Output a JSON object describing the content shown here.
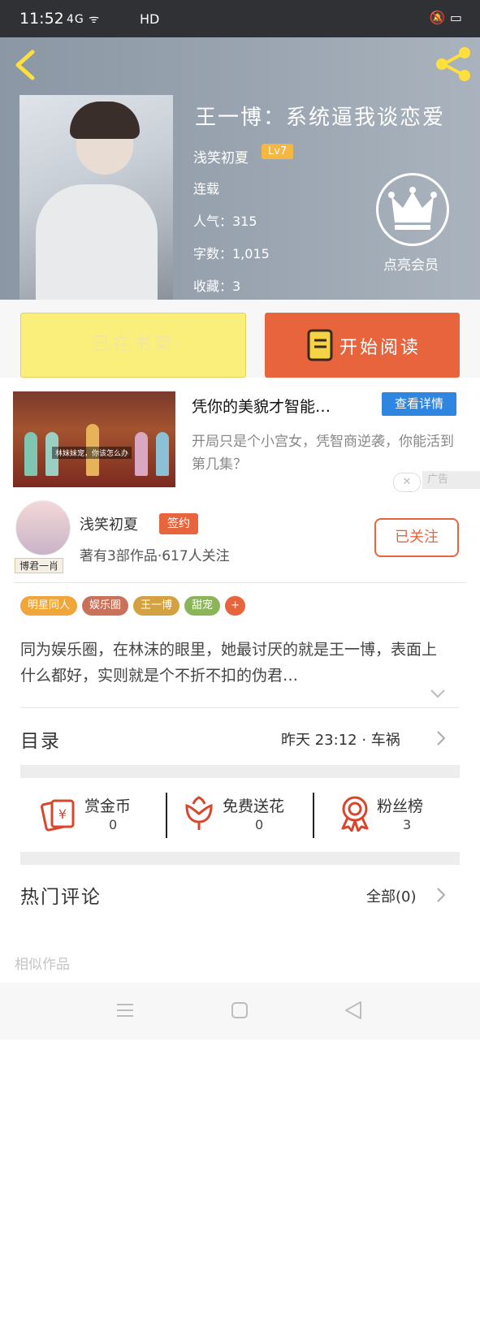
{
  "status_bar": {
    "time": "11:52",
    "network": "4G  ᯤ",
    "hd": "HD",
    "right_icons": "🔕 ▭"
  },
  "header": {
    "back_icon": "chevron-left-icon",
    "share_icon": "share-icon"
  },
  "book": {
    "title": "王一博：系统逼我谈恋爱",
    "author": "浅笑初夏",
    "level": "Lv7",
    "status": "连载",
    "popularity": "人气：315",
    "word_count": "字数：1,015",
    "favorites": "收藏：3",
    "member_label": "点亮会员"
  },
  "actions": {
    "shelf_label": "已在书架",
    "read_label": "开始阅读"
  },
  "ad": {
    "title": "凭你的美貌才智能…",
    "detail_button": "查看详情",
    "description": "开局只是个小宫女，凭智商逆袭，你能活到第几集？",
    "image_caption": "林妹妹宠，你该怎么办",
    "close_label": "✕",
    "ad_label": "广告"
  },
  "author_card": {
    "name": "浅笑初夏",
    "badge": "签约",
    "avatar_tag": "博君一肖",
    "works_followers": "著有3部作品·617人关注",
    "follow_button": "已关注"
  },
  "tags": [
    {
      "label": "明星同人",
      "color": "#f0a63a"
    },
    {
      "label": "娱乐圈",
      "color": "#c9715a"
    },
    {
      "label": "王一博",
      "color": "#d3a13f"
    },
    {
      "label": "甜宠",
      "color": "#8cb55a"
    },
    {
      "label": "+",
      "color": "#e8643c"
    }
  ],
  "synopsis": "同为娱乐圈，在林沫的眼里，她最讨厌的就是王一博，表面上什么都好，实则就是个不折不扣的伪君…",
  "catalog": {
    "title": "目录",
    "latest": "昨天 23:12 · 车祸"
  },
  "stats": [
    {
      "icon": "red-envelope-icon",
      "label": "赏金币",
      "value": "0"
    },
    {
      "icon": "flower-icon",
      "label": "免费送花",
      "value": "0"
    },
    {
      "icon": "medal-icon",
      "label": "粉丝榜",
      "value": "3"
    }
  ],
  "comments": {
    "title": "热门评论",
    "all_label": "全部(0)"
  },
  "similar_title": "相似作品",
  "accent_color": "#e8643c",
  "nav_icons": [
    "menu-icon",
    "home-icon",
    "back-triangle-icon"
  ]
}
